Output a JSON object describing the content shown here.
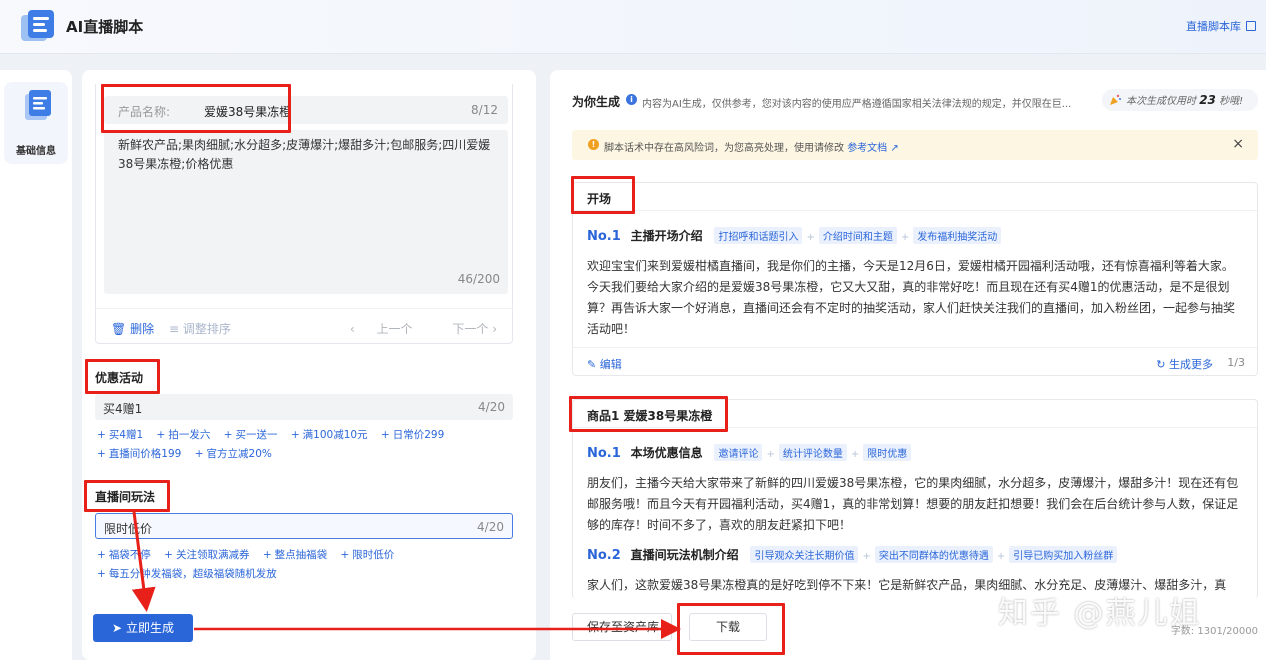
{
  "app": {
    "title": "AI直播脚本",
    "top_link": "直播脚本库"
  },
  "sidebar": {
    "items": [
      {
        "label": "基础信息"
      }
    ]
  },
  "product": {
    "name_label": "产品名称:",
    "name_value": "爱媛38号果冻橙",
    "name_count": "8/12",
    "desc": "新鲜农产品;果肉细腻;水分超多;皮薄爆汁;爆甜多汁;包邮服务;四川爱媛38号果冻橙;价格优惠",
    "desc_count": "46/200",
    "delete": "删除",
    "sort": "调整排序",
    "prev": "上一个",
    "next": "下一个"
  },
  "promo": {
    "title": "优惠活动",
    "value": "买4赠1",
    "count": "4/20",
    "chips": [
      "买4赠1",
      "拍一发六",
      "买一送一",
      "满100减10元",
      "日常价299",
      "直播间价格199",
      "官方立减20%"
    ]
  },
  "play": {
    "title": "直播间玩法",
    "value": "限时低价",
    "count": "4/20",
    "chips": [
      "福袋不停",
      "关注领取满减券",
      "整点抽福袋",
      "限时低价",
      "每五分钟发福袋，超级福袋随机发放"
    ]
  },
  "generate_button": "立即生成",
  "result": {
    "title": "为你生成",
    "note": "内容为AI生成，仅供参考，您对该内容的使用应严格遵循国家相关法律法规的规定，并仅限在巨...",
    "time_prefix": "本次生成仅用时",
    "time_value": "23",
    "time_suffix": "秒哦!",
    "warning": "脚本话术中存在高风险词，为您高亮处理，使用请修改",
    "warning_link": "参考文档",
    "close": "×",
    "sections": [
      {
        "title": "开场",
        "segments": [
          {
            "no": "No.1",
            "name": "主播开场介绍",
            "tags": [
              "打招呼和话题引入",
              "介绍时间和主题",
              "发布福利抽奖活动"
            ],
            "text": "欢迎宝宝们来到爱媛柑橘直播间，我是你们的主播，今天是12月6日，爱媛柑橘开园福利活动哦，还有惊喜福利等着大家。今天我们要给大家介绍的是爱媛38号果冻橙，它又大又甜，真的非常好吃！而且现在还有买4赠1的优惠活动，是不是很划算？再告诉大家一个好消息，直播间还会有不定时的抽奖活动，家人们赶快关注我们的直播间，加入粉丝团，一起参与抽奖活动吧！"
          }
        ],
        "edit": "编辑",
        "more": "生成更多",
        "page": "1/3"
      },
      {
        "title": "商品1 爱媛38号果冻橙",
        "segments": [
          {
            "no": "No.1",
            "name": "本场优惠信息",
            "tags": [
              "邀请评论",
              "统计评论数量",
              "限时优惠"
            ],
            "text": "朋友们，主播今天给大家带来了新鲜的四川爱媛38号果冻橙，它的果肉细腻，水分超多，皮薄爆汁，爆甜多汁！现在还有包邮服务哦！而且今天有开园福利活动，买4赠1，真的非常划算！想要的朋友赶扣想要！我们会在后台统计参与人数，保证足够的库存！时间不多了，喜欢的朋友赶紧扣下吧！"
          },
          {
            "no": "No.2",
            "name": "直播间玩法机制介绍",
            "tags": [
              "引导观众关注长期价值",
              "突出不同群体的优惠待遇",
              "引导已购买加入粉丝群"
            ],
            "text": "家人们，这款爱媛38号果冻橙真的是好吃到停不下来！它是新鲜农产品，果肉细腻、水分充足、皮薄爆汁、爆甜多汁，真"
          }
        ]
      }
    ],
    "save_button": "保存至资产库",
    "download_button": "下载",
    "word_count": "字数: 1301/20000",
    "watermark": "知乎 @燕儿姐"
  },
  "colors": {
    "accent": "#2b66d9",
    "highlight": "#e8201a",
    "warning_bg": "#fdf6e3"
  }
}
